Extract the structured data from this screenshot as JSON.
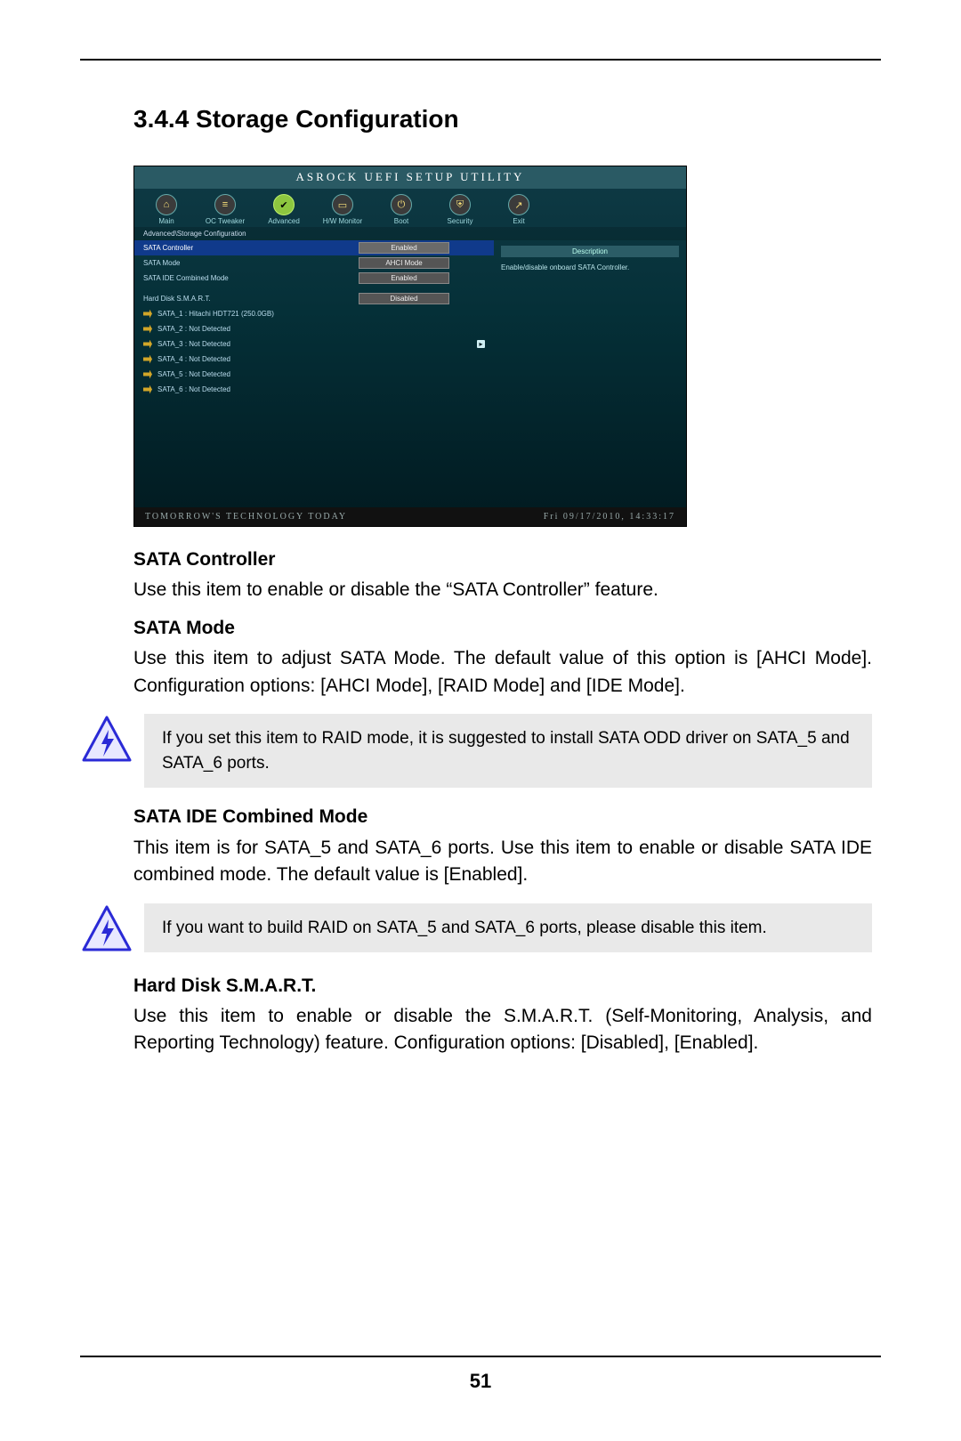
{
  "page_number": "51",
  "section_title": "3.4.4  Storage Configuration",
  "bios": {
    "titlebar": "ASROCK UEFI SETUP UTILITY",
    "tabs": [
      {
        "icon": "⌂",
        "label": "Main"
      },
      {
        "icon": "≡",
        "label": "OC Tweaker"
      },
      {
        "icon": "✔",
        "label": "Advanced",
        "active": true
      },
      {
        "icon": "▭",
        "label": "H/W Monitor"
      },
      {
        "icon": "⏻",
        "label": "Boot"
      },
      {
        "icon": "⛨",
        "label": "Security"
      },
      {
        "icon": "↗",
        "label": "Exit"
      }
    ],
    "breadcrumb": "Advanced\\Storage Configuration",
    "options": [
      {
        "label": "SATA Controller",
        "value": "Enabled",
        "selected": true
      },
      {
        "label": "SATA Mode",
        "value": "AHCI Mode"
      },
      {
        "label": "SATA IDE Combined Mode",
        "value": "Enabled"
      },
      {
        "label": "Hard Disk S.M.A.R.T.",
        "value": "Disabled"
      }
    ],
    "ports": [
      {
        "label": "SATA_1 : Hitachi HDT721 (250.0GB)"
      },
      {
        "label": "SATA_2 : Not Detected"
      },
      {
        "label": "SATA_3 : Not Detected"
      },
      {
        "label": "SATA_4 : Not Detected"
      },
      {
        "label": "SATA_5 : Not Detected"
      },
      {
        "label": "SATA_6 : Not Detected"
      }
    ],
    "desc_title": "Description",
    "desc_text": "Enable/disable onboard SATA Controller.",
    "footer_left": "TOMORROW'S TECHNOLOGY TODAY",
    "footer_right": "Fri  09/17/2010,  14:33:17"
  },
  "items": {
    "sata_controller": {
      "title": "SATA Controller",
      "body": "Use this item to enable or disable the “SATA Controller” feature."
    },
    "sata_mode": {
      "title": "SATA Mode",
      "body": "Use this item to adjust SATA Mode. The default value of this option is [AHCI Mode]. Configuration options: [AHCI Mode], [RAID Mode] and [IDE Mode]."
    },
    "note1": "If you set this item to RAID mode, it is suggested to install SATA ODD driver on SATA_5 and SATA_6 ports.",
    "sata_ide_combined": {
      "title": "SATA IDE Combined Mode",
      "body": "This item is for SATA_5 and SATA_6 ports. Use this item to enable or disable SATA IDE combined mode. The default value is [Enabled]."
    },
    "note2": "If you want to build RAID on SATA_5 and SATA_6 ports, please disable this item.",
    "smart": {
      "title": "Hard Disk S.M.A.R.T.",
      "body": "Use this item to enable or disable the S.M.A.R.T. (Self-Monitoring, Analysis, and Reporting Technology) feature. Configuration options: [Disabled], [Enabled]."
    }
  }
}
